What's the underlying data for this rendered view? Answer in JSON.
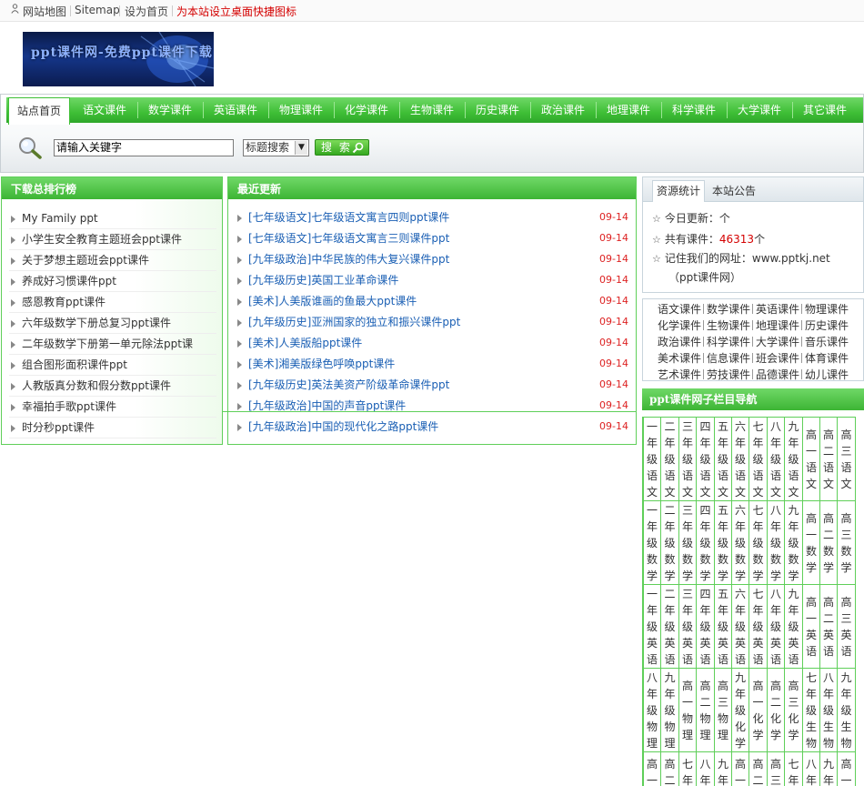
{
  "topbar": {
    "sitemap_cn": "网站地图",
    "sitemap_en": "Sitemap",
    "set_home": "设为首页",
    "shortcut": "为本站设立桌面快捷图标",
    "shortcut_color": "#d40000"
  },
  "logo": {
    "text": "ppt课件网-免费ppt课件下载"
  },
  "nav": {
    "home": "站点首页",
    "items": [
      "语文课件",
      "数学课件",
      "英语课件",
      "物理课件",
      "化学课件",
      "生物课件",
      "历史课件",
      "政治课件",
      "地理课件",
      "科学课件",
      "大学课件",
      "其它课件"
    ]
  },
  "search": {
    "value": "请输入关键字",
    "select": "标题搜索",
    "button": "搜 索"
  },
  "ranking": {
    "title": "下载总排行榜",
    "items": [
      "My Family ppt",
      "小学生安全教育主题班会ppt课件",
      "关于梦想主题班会ppt课件",
      "养成好习惯课件ppt",
      "感恩教育ppt课件",
      "六年级数学下册总复习ppt课件",
      "二年级数学下册第一单元除法ppt课",
      "组合图形面积课件ppt",
      "人教版真分数和假分数ppt课件",
      "幸福拍手歌ppt课件",
      "时分秒ppt课件"
    ]
  },
  "recent": {
    "title": "最近更新",
    "items": [
      {
        "text": "[七年级语文]七年级语文寓言四则ppt课件",
        "date": "09-14"
      },
      {
        "text": "[七年级语文]七年级语文寓言三则课件ppt",
        "date": "09-14"
      },
      {
        "text": "[九年级政治]中华民族的伟大复兴课件ppt",
        "date": "09-14"
      },
      {
        "text": "[九年级历史]英国工业革命课件",
        "date": "09-14"
      },
      {
        "text": "[美术]人美版谁画的鱼最大ppt课件",
        "date": "09-14"
      },
      {
        "text": "[九年级历史]亚洲国家的独立和振兴课件ppt",
        "date": "09-14"
      },
      {
        "text": "[美术]人美版船ppt课件",
        "date": "09-14"
      },
      {
        "text": "[美术]湘美版绿色呼唤ppt课件",
        "date": "09-14"
      },
      {
        "text": "[九年级历史]英法美资产阶级革命课件ppt",
        "date": "09-14"
      },
      {
        "text": "[九年级政治]中国的声音ppt课件",
        "date": "09-14"
      },
      {
        "text": "[九年级政治]中国的现代化之路ppt课件",
        "date": "09-14"
      }
    ]
  },
  "stats": {
    "tab_active": "资源统计",
    "tab_other": "本站公告",
    "today": "今日更新：个",
    "total_prefix": "共有课件：",
    "total_value": "46313",
    "total_suffix": "个",
    "total_color": "#d40000",
    "remember": "记住我们的网址：www.pptkj.net",
    "remember_sub": "（ppt课件网）"
  },
  "course_grid": [
    [
      "语文课件",
      "数学课件",
      "英语课件",
      "物理课件"
    ],
    [
      "化学课件",
      "生物课件",
      "地理课件",
      "历史课件"
    ],
    [
      "政治课件",
      "科学课件",
      "大学课件",
      "音乐课件"
    ],
    [
      "美术课件",
      "信息课件",
      "班会课件",
      "体育课件"
    ],
    [
      "艺术课件",
      "劳技课件",
      "品德课件",
      "幼儿课件"
    ]
  ],
  "column_nav": {
    "title": "ppt课件网子栏目导航",
    "rows": [
      [
        "一年级语文",
        "二年级语文",
        "三年级语文",
        "四年级语文",
        "五年级语文",
        "六年级语文",
        "七年级语文",
        "八年级语文",
        "九年级语文",
        "高一语文",
        "高二语文",
        "高三语文"
      ],
      [
        "一年级数学",
        "二年级数学",
        "三年级数学",
        "四年级数学",
        "五年级数学",
        "六年级数学",
        "七年级数学",
        "八年级数学",
        "九年级数学",
        "高一数学",
        "高二数学",
        "高三数学"
      ],
      [
        "一年级英语",
        "二年级英语",
        "三年级英语",
        "四年级英语",
        "五年级英语",
        "六年级英语",
        "七年级英语",
        "八年级英语",
        "九年级英语",
        "高一英语",
        "高二英语",
        "高三英语"
      ],
      [
        "八年级物理",
        "九年级物理",
        "高一物理",
        "高二物理",
        "高三物理",
        "九年级化学",
        "高一化学",
        "高二化学",
        "高三化学",
        "七年级生物",
        "八年级生物",
        "九年级生物"
      ],
      [
        "高一",
        "高二",
        "七年",
        "八年",
        "九年",
        "高一",
        "高二",
        "高三",
        "七年",
        "八年",
        "九年",
        "高一"
      ]
    ]
  }
}
